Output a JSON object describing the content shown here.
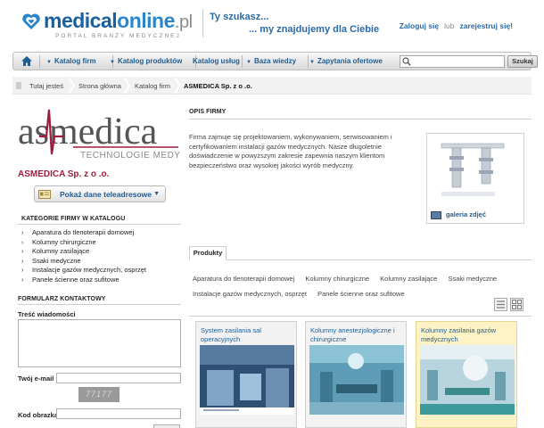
{
  "header": {
    "logo": {
      "part1": "medical",
      "part2": "online",
      "part3": ".pl",
      "subtitle": "PORTAL BRANŻY MEDYCZNEJ"
    },
    "tagline": {
      "line1": "Ty szukasz...",
      "line2": "... my znajdujemy dla Ciebie"
    },
    "auth": {
      "login": "Zaloguj się",
      "or": "lub",
      "register": "zarejestruj się!"
    }
  },
  "nav": {
    "items": [
      "Katalog firm",
      "Katalog produktów",
      "Katalog usług",
      "Baza wiedzy",
      "Zapytania ofertowe"
    ],
    "search_placeholder": "",
    "search_button": "Szukaj"
  },
  "breadcrumb": [
    "Tutaj jesteś",
    "Strona główna",
    "Katalog firm",
    "ASMEDICA Sp. z o .o."
  ],
  "company": {
    "logo_text": "asmedica",
    "logo_sub": "TECHNOLOGIE MEDYCZNE",
    "name": "ASMEDICA Sp. z o .o.",
    "contact_button": "Pokaż dane teleadresowe"
  },
  "categories": {
    "title": "KATEGORIE FIRMY W KATALOGU",
    "items": [
      "Aparatura do tlenoterapii domowej",
      "Kolumny chirurgiczne",
      "Kolumny zasilające",
      "Ssaki medyczne",
      "Instalacje gazów medycznych, osprzęt",
      "Panele ścienne oraz sufitowe"
    ]
  },
  "contact_form": {
    "title": "FORMULARZ KONTAKTOWY",
    "message_label": "Treść wiadomości",
    "email_label": "Twój e-mail",
    "captcha_text": "77177",
    "captcha_label": "Kod obrazka"
  },
  "description": {
    "title": "OPIS FIRMY",
    "text": "Firma zajmuje się projektowaniem, wykonywaniem, serwisowaniem i certyfikowaniem instalacji gazów medycznych. Nasze długoletnie doświadczenie w powyższym zakresie zapewnia naszym klientom bezpieczeństwo oraz wysokiej jakości wyrób medyczny.",
    "gallery_link": "galeria zdjęć"
  },
  "products": {
    "tab": "Produkty",
    "categories": [
      "Aparatura do tlenoterapii domowej",
      "Kolumny chirurgiczne",
      "Kolumny zasilające",
      "Ssaki medyczne",
      "Instalacje gazów medycznych, osprzęt",
      "Panele ścienne oraz sufitowe"
    ],
    "cards": [
      {
        "title": "System zasilania sal operacyjnych"
      },
      {
        "title": "Kolumny anestezjologiczne i chirurgiczne"
      },
      {
        "title": "Kolumny zasilania gazów medycznych"
      }
    ]
  },
  "colors": {
    "brand_blue": "#1f5c93",
    "company_red": "#a01c3c",
    "highlight": "#fdf3c6"
  }
}
